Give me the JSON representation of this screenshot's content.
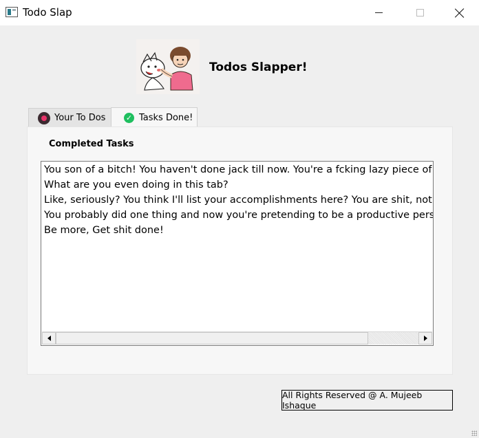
{
  "window": {
    "title": "Todo Slap"
  },
  "header": {
    "title": "Todos Slapper!",
    "logo_icon": "cartoon-slap-icon"
  },
  "tabs": [
    {
      "label": "Your To Dos",
      "icon": "record-icon",
      "active": false
    },
    {
      "label": "Tasks Done!",
      "icon": "check-circle-icon",
      "active": true
    }
  ],
  "panel": {
    "title": "Completed Tasks",
    "lines": [
      "You son of a bitch! You haven't done jack till now. You're a fcking lazy piece of shit.",
      "What are you even doing in this tab?",
      "Like, seriously? You think I'll list your accomplishments here? You are shit, nothing else",
      "You probably did one thing and now you're pretending to be a productive person? YO",
      "Be more, Get shit done!"
    ]
  },
  "footer": {
    "text": "All Rights Reserved @ A. Mujeeb Ishaque"
  },
  "colors": {
    "check_green": "#1fbf5f",
    "record_pink": "#e8336a"
  }
}
